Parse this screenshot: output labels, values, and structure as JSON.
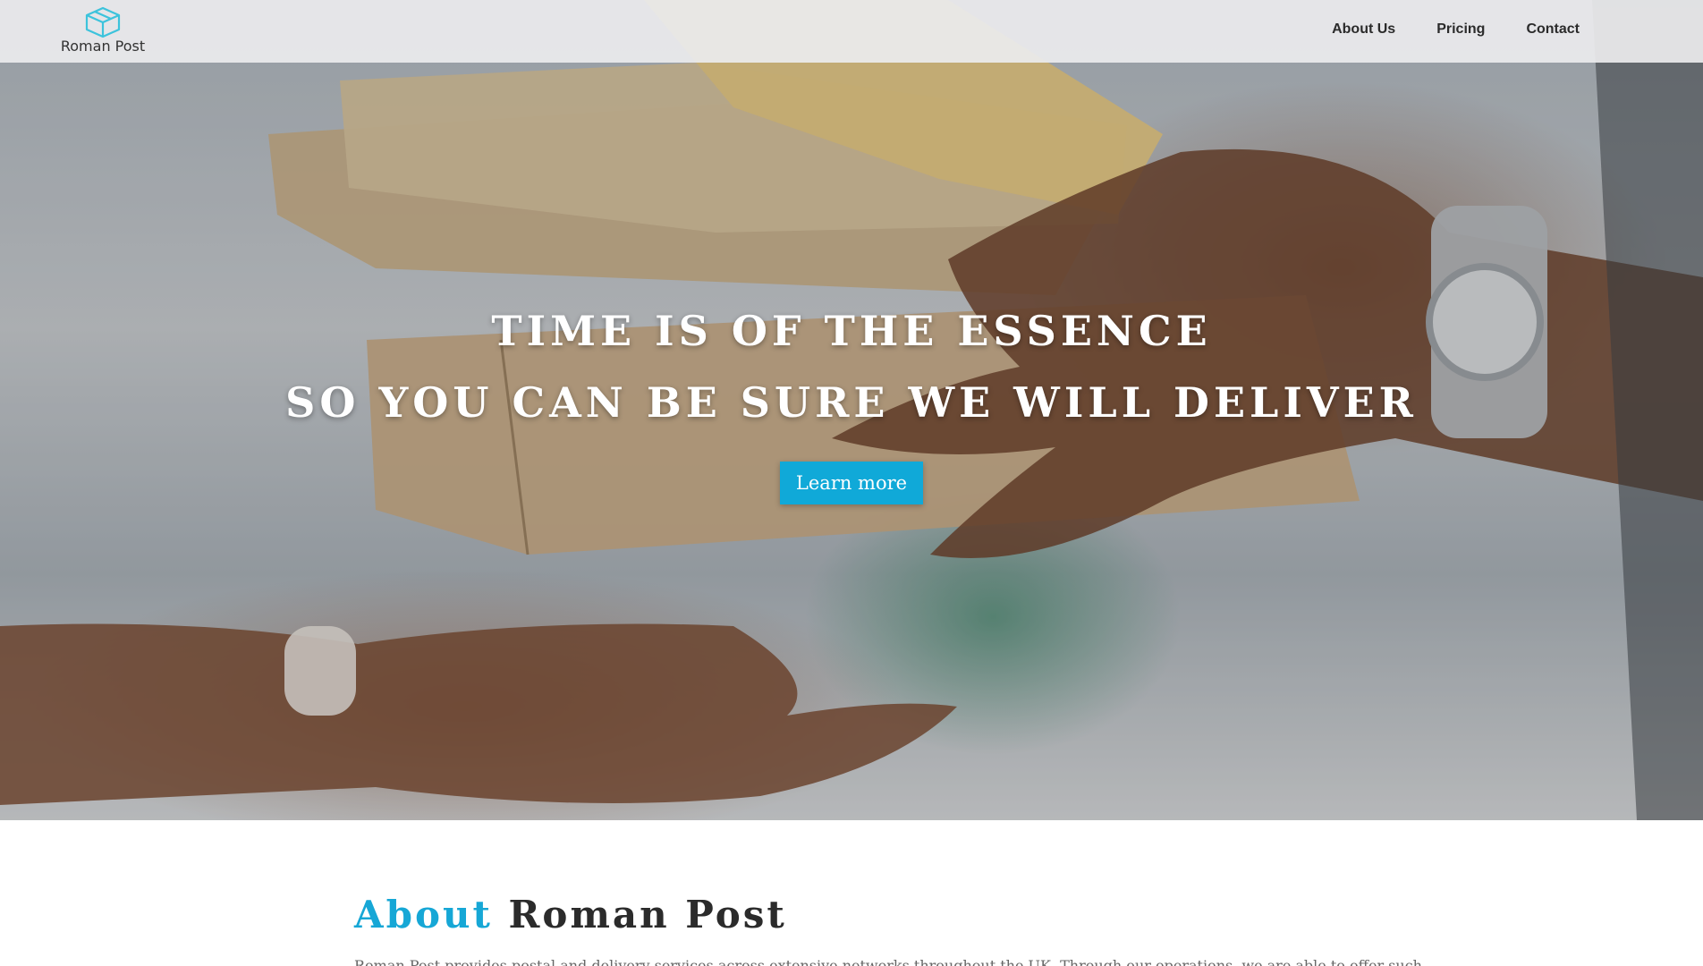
{
  "brand": {
    "name": "Roman Post",
    "accent_color": "#10a9d8"
  },
  "nav": {
    "items": [
      {
        "label": "About Us"
      },
      {
        "label": "Pricing"
      },
      {
        "label": "Contact"
      }
    ]
  },
  "hero": {
    "line1": "TIME IS OF THE ESSENCE",
    "line2": "SO YOU CAN BE SURE WE WILL DELIVER",
    "button_label": "Learn more"
  },
  "about": {
    "title_accent": "About",
    "title_rest": "Roman Post",
    "text": "Roman Post provides postal and delivery services across extensive networks throughout the UK. Through our operations, we are able to offer such"
  }
}
